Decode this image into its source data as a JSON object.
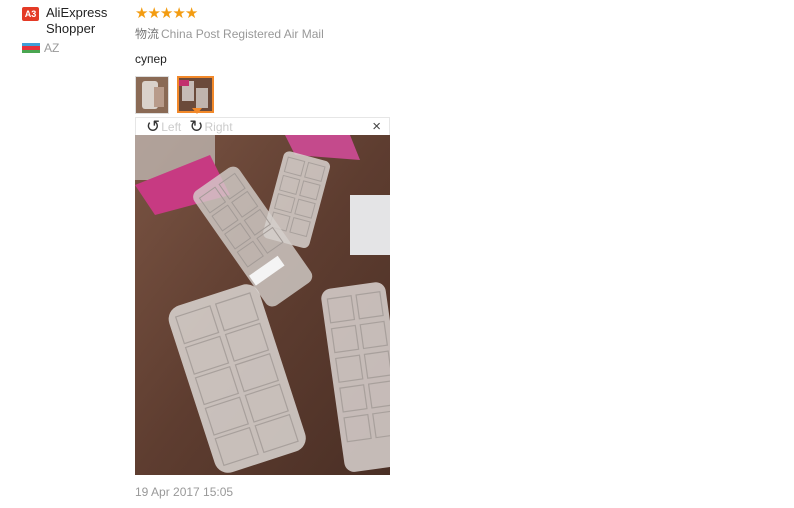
{
  "user": {
    "level": "A3",
    "name": "AliExpress Shopper",
    "country": "AZ"
  },
  "review": {
    "rating": 5,
    "shipping": "China Post Registered Air Mail",
    "logistics_label": "物流",
    "text": "супер",
    "date": "19 Apr 2017 15:05"
  },
  "viewer": {
    "rotate_left": "Left",
    "rotate_right": "Right",
    "close": "×"
  },
  "colors": {
    "star": "#f39c11",
    "badge": "#e43a26",
    "active_thumb": "#f2892a"
  }
}
